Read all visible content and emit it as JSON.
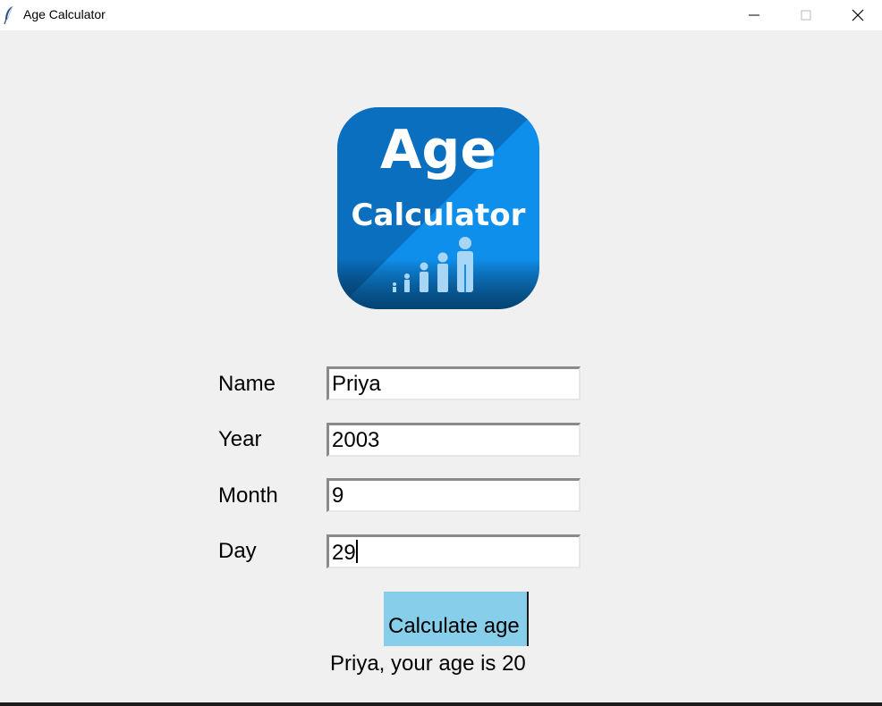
{
  "window": {
    "title": "Age Calculator",
    "controls": {
      "minimize": "minimize-icon",
      "maximize": "maximize-icon",
      "close": "close-icon"
    }
  },
  "logo": {
    "line1": "Age",
    "line2": "Calculator",
    "icon": "growing-people-icon",
    "colors": {
      "dark_blue": "#0a6fbf",
      "light_blue": "#0f8fec",
      "figures": "#a9d6f4"
    }
  },
  "form": {
    "fields": [
      {
        "label": "Name",
        "value": "Priya"
      },
      {
        "label": "Year",
        "value": "2003"
      },
      {
        "label": "Month",
        "value": "9"
      },
      {
        "label": "Day",
        "value": "29"
      }
    ],
    "button_label": "Calculate age",
    "button_color": "#87ceeb",
    "result": "Priya, your age is 20"
  }
}
